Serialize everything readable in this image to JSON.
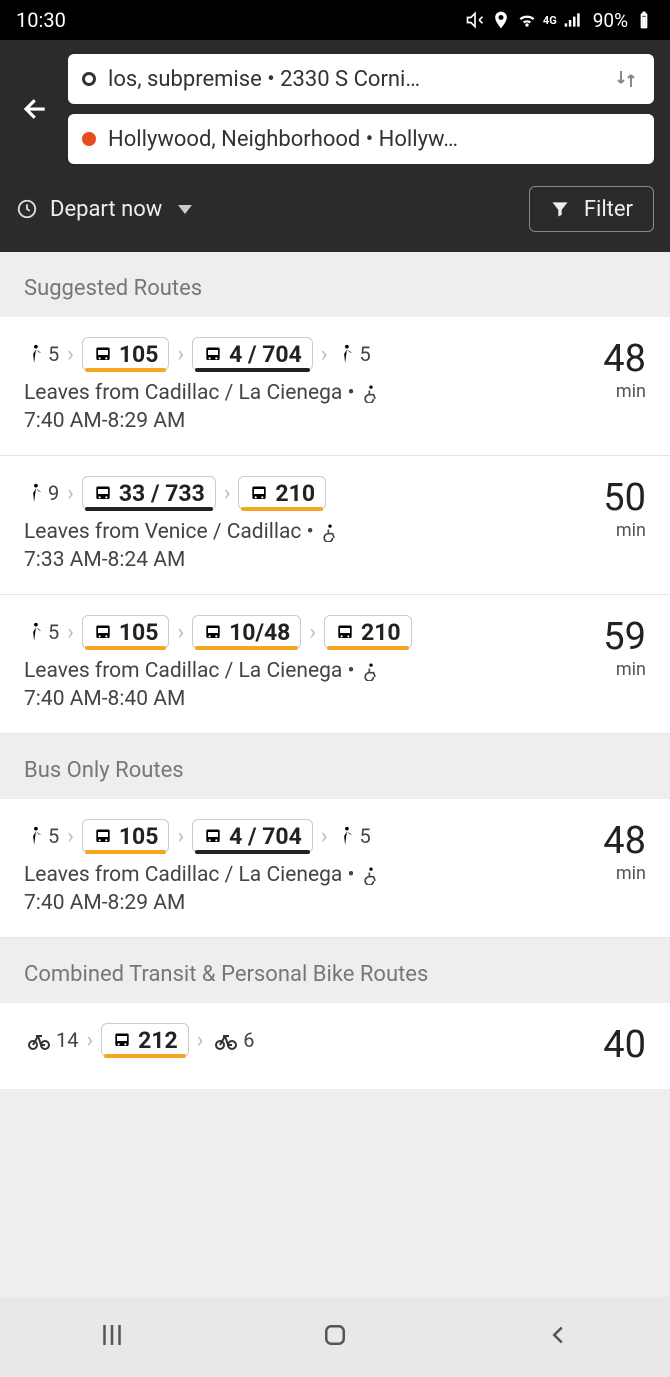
{
  "status": {
    "time": "10:30",
    "battery": "90%"
  },
  "header": {
    "origin": "los, subpremise  •  2330 S Corni…",
    "destination": "Hollywood, Neighborhood  •  Hollyw…",
    "depart_label": "Depart now",
    "filter_label": "Filter"
  },
  "sections": [
    {
      "title": "Suggested Routes"
    },
    {
      "title": "Bus Only Routes"
    },
    {
      "title": "Combined Transit & Personal Bike Routes"
    }
  ],
  "routes": [
    {
      "walk1": "5",
      "bus1": "105",
      "bus1_color": "orange",
      "bus2": "4 / 704",
      "bus2_color": "dark",
      "walk2": "5",
      "desc": "Leaves from Cadillac / La Cienega •",
      "time": "7:40 AM-8:29 AM",
      "dur": "48",
      "unit": "min"
    },
    {
      "walk1": "9",
      "bus1": "33 / 733",
      "bus1_color": "dark",
      "bus2": "210",
      "bus2_color": "orange",
      "desc": "Leaves from Venice / Cadillac •",
      "time": "7:33 AM-8:24 AM",
      "dur": "50",
      "unit": "min"
    },
    {
      "walk1": "5",
      "bus1": "105",
      "bus1_color": "orange",
      "bus2": "10/48",
      "bus2_color": "orange",
      "bus3": "210",
      "bus3_color": "orange",
      "desc": "Leaves from Cadillac / La Cienega •",
      "time": "7:40 AM-8:40 AM",
      "dur": "59",
      "unit": "min"
    },
    {
      "walk1": "5",
      "bus1": "105",
      "bus1_color": "orange",
      "bus2": "4 / 704",
      "bus2_color": "dark",
      "walk2": "5",
      "desc": "Leaves from Cadillac / La Cienega •",
      "time": "7:40 AM-8:29 AM",
      "dur": "48",
      "unit": "min"
    },
    {
      "bike1": "14",
      "bus1": "212",
      "bus1_color": "orange",
      "bike2": "6",
      "dur": "40",
      "unit": ""
    }
  ]
}
